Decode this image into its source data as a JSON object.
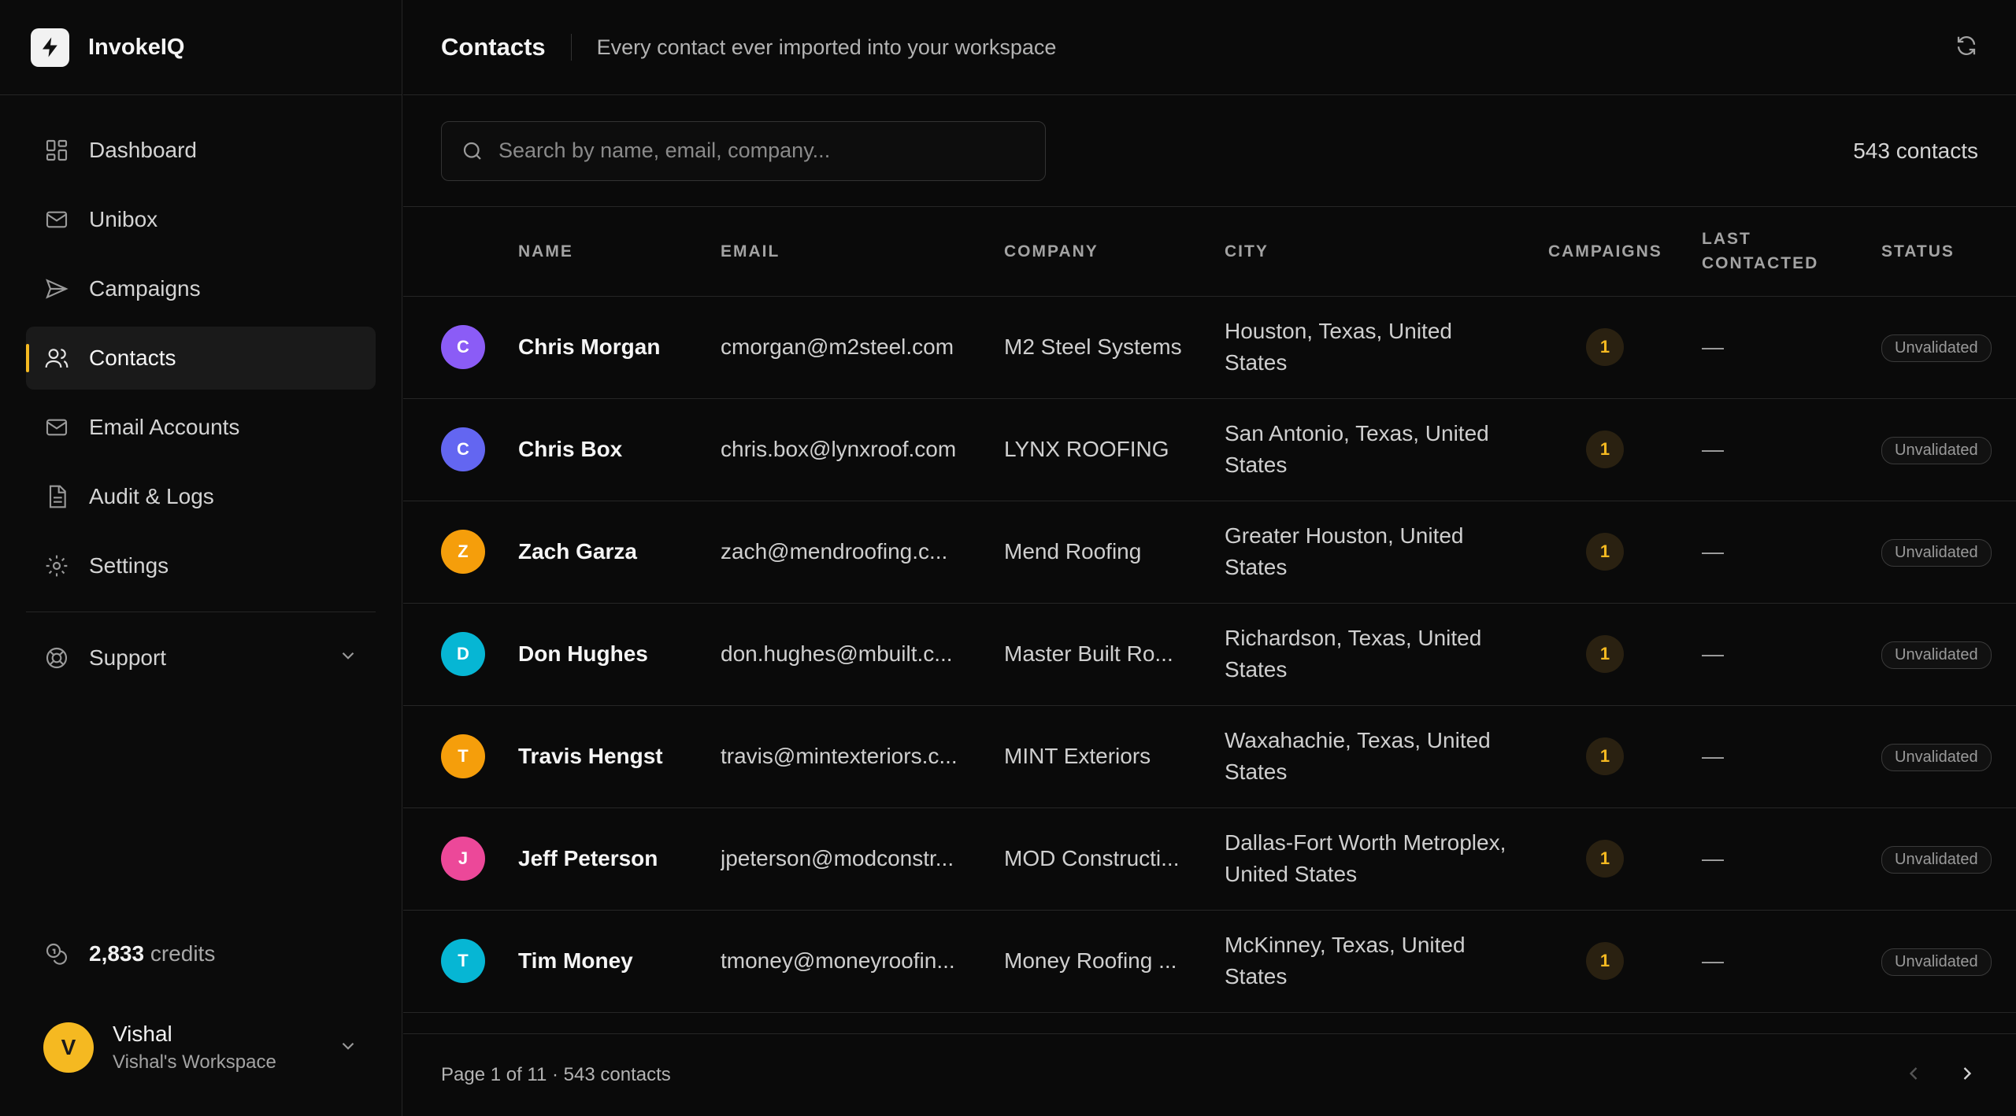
{
  "brand": {
    "name": "InvokeIQ"
  },
  "nav": {
    "items": [
      {
        "label": "Dashboard",
        "icon": "dashboard-icon"
      },
      {
        "label": "Unibox",
        "icon": "mail-icon"
      },
      {
        "label": "Campaigns",
        "icon": "send-icon"
      },
      {
        "label": "Contacts",
        "icon": "users-icon",
        "active": true
      },
      {
        "label": "Email Accounts",
        "icon": "mail-icon"
      },
      {
        "label": "Audit & Logs",
        "icon": "file-text-icon"
      },
      {
        "label": "Settings",
        "icon": "gear-icon"
      }
    ],
    "support": "Support"
  },
  "credits": {
    "value": "2,833",
    "label": "credits"
  },
  "user": {
    "initial": "V",
    "name": "Vishal",
    "workspace": "Vishal's Workspace"
  },
  "header": {
    "title": "Contacts",
    "subtitle": "Every contact ever imported into your workspace"
  },
  "search": {
    "placeholder": "Search by name, email, company...",
    "value": ""
  },
  "contact_count": "543 contacts",
  "table": {
    "columns": [
      "NAME",
      "EMAIL",
      "COMPANY",
      "CITY",
      "CAMPAIGNS",
      "LAST CONTACTED",
      "STATUS"
    ],
    "rows": [
      {
        "initial": "C",
        "color": "#8b5cf6",
        "name": "Chris Morgan",
        "email": "cmorgan@m2steel.com",
        "company": "M2 Steel Systems",
        "city": "Houston, Texas, United States",
        "campaigns": "1",
        "last_contacted": "—",
        "status": "Unvalidated"
      },
      {
        "initial": "C",
        "color": "#6366f1",
        "name": "Chris Box",
        "email": "chris.box@lynxroof.com",
        "company": "LYNX ROOFING",
        "city": "San Antonio, Texas, United States",
        "campaigns": "1",
        "last_contacted": "—",
        "status": "Unvalidated"
      },
      {
        "initial": "Z",
        "color": "#f59e0b",
        "name": "Zach Garza",
        "email": "zach@mendroofing.c...",
        "company": "Mend Roofing",
        "city": "Greater Houston, United States",
        "campaigns": "1",
        "last_contacted": "—",
        "status": "Unvalidated"
      },
      {
        "initial": "D",
        "color": "#06b6d4",
        "name": "Don Hughes",
        "email": "don.hughes@mbuilt.c...",
        "company": "Master Built Ro...",
        "city": "Richardson, Texas, United States",
        "campaigns": "1",
        "last_contacted": "—",
        "status": "Unvalidated"
      },
      {
        "initial": "T",
        "color": "#f59e0b",
        "name": "Travis Hengst",
        "email": "travis@mintexteriors.c...",
        "company": "MINT Exteriors",
        "city": "Waxahachie, Texas, United States",
        "campaigns": "1",
        "last_contacted": "—",
        "status": "Unvalidated"
      },
      {
        "initial": "J",
        "color": "#ec4899",
        "name": "Jeff Peterson",
        "email": "jpeterson@modconstr...",
        "company": "MOD Constructi...",
        "city": "Dallas-Fort Worth Metroplex, United States",
        "campaigns": "1",
        "last_contacted": "—",
        "status": "Unvalidated"
      },
      {
        "initial": "T",
        "color": "#06b6d4",
        "name": "Tim Money",
        "email": "tmoney@moneyroofin...",
        "company": "Money Roofing ...",
        "city": "McKinney, Texas, United States",
        "campaigns": "1",
        "last_contacted": "—",
        "status": "Unvalidated"
      }
    ]
  },
  "pagination": {
    "info": "Page 1 of 11 · 543 contacts"
  }
}
